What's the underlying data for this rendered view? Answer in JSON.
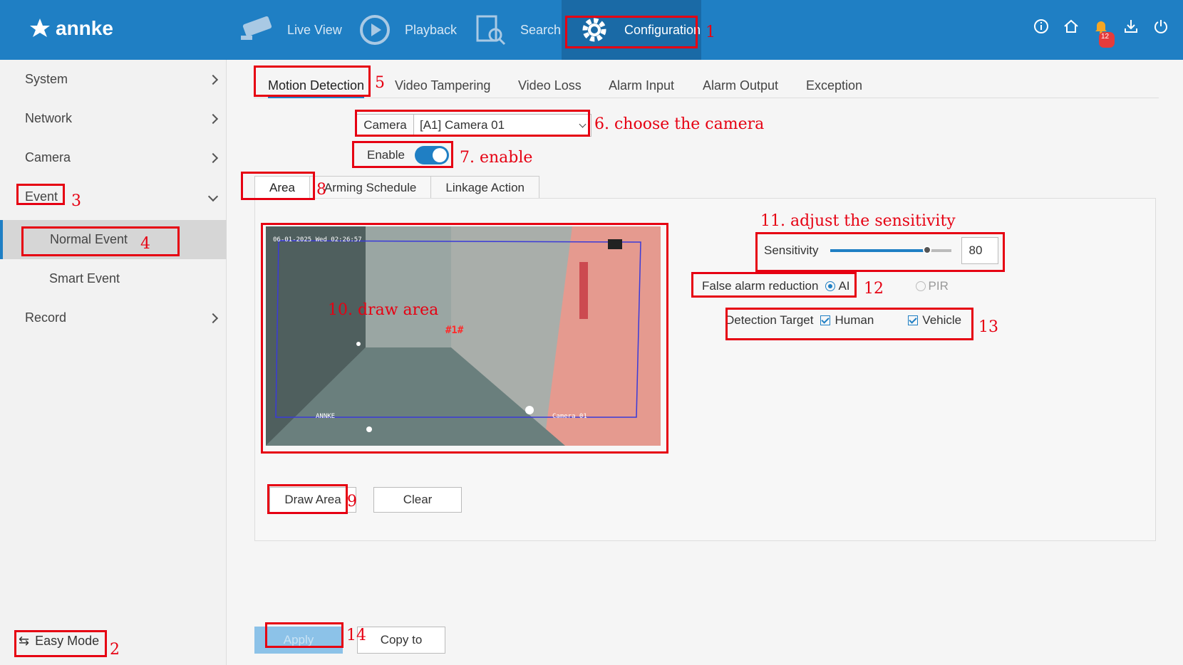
{
  "header": {
    "brand": "annke",
    "nav": [
      {
        "label": "Live View",
        "icon": "camera-icon"
      },
      {
        "label": "Playback",
        "icon": "play-icon"
      },
      {
        "label": "Search",
        "icon": "search-doc-icon"
      },
      {
        "label": "Configuration",
        "icon": "gear-icon"
      }
    ],
    "notification_count": "12"
  },
  "sidebar": {
    "items": [
      {
        "label": "System"
      },
      {
        "label": "Network"
      },
      {
        "label": "Camera"
      },
      {
        "label": "Event"
      },
      {
        "label": "Normal Event"
      },
      {
        "label": "Smart Event"
      },
      {
        "label": "Record"
      }
    ],
    "easy_mode": "Easy Mode"
  },
  "tabs": [
    "Motion Detection",
    "Video Tampering",
    "Video Loss",
    "Alarm Input",
    "Alarm Output",
    "Exception"
  ],
  "camera": {
    "label": "Camera",
    "value": "[A1] Camera 01"
  },
  "enable": {
    "label": "Enable",
    "on": true
  },
  "subtabs": [
    "Area",
    "Arming Schedule",
    "Linkage Action"
  ],
  "video": {
    "osd_time": "06-01-2025 Wed 02:26:57",
    "osd_brand": "ANNKE",
    "osd_camera": "Camera 01",
    "area_label": "#1#"
  },
  "buttons": {
    "draw_area": "Draw Area",
    "clear": "Clear",
    "apply": "Apply",
    "copy_to": "Copy to"
  },
  "sensitivity": {
    "label": "Sensitivity",
    "value": "80",
    "level": 0.8
  },
  "false_alarm": {
    "label": "False alarm reduction",
    "opt_ai": "AI",
    "opt_pir": "PIR",
    "selected": "AI"
  },
  "detection_target": {
    "label": "Detection Target",
    "human": "Human",
    "vehicle": "Vehicle"
  },
  "annotations": {
    "n1": "1",
    "n2": "2",
    "n3": "3",
    "n4": "4",
    "n5": "5",
    "n6": "6. choose the camera",
    "n7": "7. enable",
    "n8": "8",
    "n9": "9",
    "n10": "10. draw area",
    "n11": "11. adjust the sensitivity",
    "n12": "12",
    "n13": "13",
    "n14": "14"
  },
  "colors": {
    "header": "#1f7fc4",
    "annotation": "#e60012"
  }
}
